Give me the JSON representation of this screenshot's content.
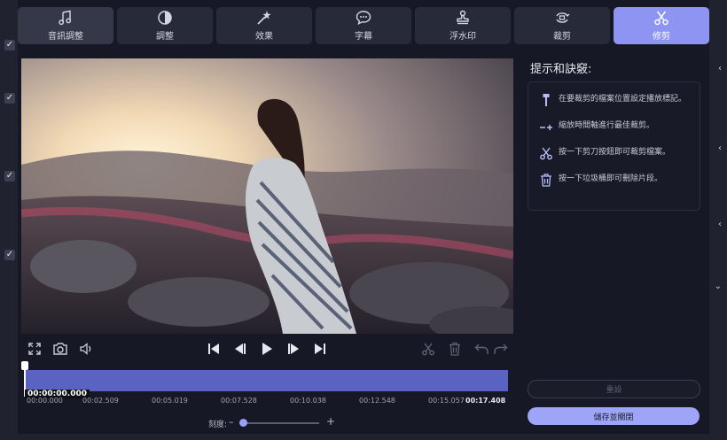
{
  "tabs": [
    {
      "label": "音訊調整",
      "icon": "music-note-icon"
    },
    {
      "label": "調整",
      "icon": "contrast-icon"
    },
    {
      "label": "效果",
      "icon": "magic-wand-icon"
    },
    {
      "label": "字幕",
      "icon": "speech-bubble-icon"
    },
    {
      "label": "浮水印",
      "icon": "stamp-icon"
    },
    {
      "label": "裁剪",
      "icon": "crop-rotate-icon"
    },
    {
      "label": "修剪",
      "icon": "scissors-icon"
    }
  ],
  "active_tab": "修剪",
  "tips": {
    "title": "提示和訣竅:",
    "items": [
      {
        "text": "在要裁剪的檔案位置設定播放標記。",
        "icon": "marker-icon"
      },
      {
        "text": "縮放時間軸進行最佳裁剪。",
        "icon": "zoom-timeline-icon"
      },
      {
        "text": "按一下剪刀按鈕即可裁剪檔案。",
        "icon": "scissors-icon"
      },
      {
        "text": "按一下垃圾桶即可刪除片段。",
        "icon": "trash-icon"
      }
    ]
  },
  "timeline": {
    "current_time": "00:00:00.000",
    "ticks": [
      "00:00.000",
      "00:02.509",
      "00:05.019",
      "00:07.528",
      "00:10.038",
      "00:12.548",
      "00:15.057",
      "00:17.408"
    ],
    "playhead_fraction": 0.0
  },
  "zoom": {
    "label": "刻度:",
    "minus": "–",
    "plus": "+",
    "level": 0.05
  },
  "buttons": {
    "reset": "重設",
    "save_close": "儲存並關閉"
  },
  "colors": {
    "accent": "#8e94f2",
    "timeline": "#5b63c2",
    "panel": "#161925"
  }
}
